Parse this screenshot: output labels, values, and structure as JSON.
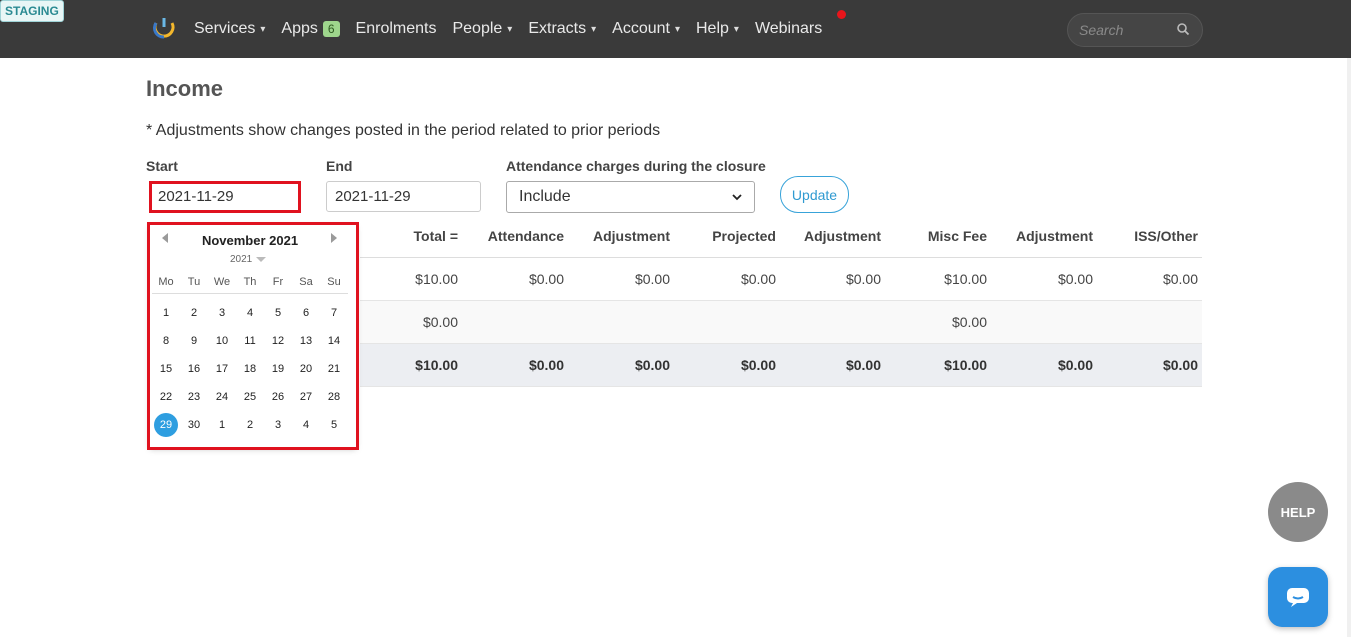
{
  "env_badge": "STAGING",
  "nav": {
    "items": [
      {
        "label": "Services",
        "dropdown": true
      },
      {
        "label": "Apps",
        "badge": "6"
      },
      {
        "label": "Enrolments"
      },
      {
        "label": "People",
        "dropdown": true
      },
      {
        "label": "Extracts",
        "dropdown": true
      },
      {
        "label": "Account",
        "dropdown": true
      },
      {
        "label": "Help",
        "dropdown": true
      },
      {
        "label": "Webinars"
      }
    ],
    "search_placeholder": "Search",
    "caret": "▾"
  },
  "page": {
    "title": "Income",
    "note": "* Adjustments show changes posted in the period related to prior periods"
  },
  "filters": {
    "start_label": "Start",
    "start_value": "2021-11-29",
    "end_label": "End",
    "end_value": "2021-11-29",
    "closure_label": "Attendance charges during the closure",
    "closure_value": "Include",
    "update_label": "Update"
  },
  "table": {
    "headers": [
      "Total =",
      "Attendance",
      "Adjustment",
      "Projected",
      "Adjustment",
      "Misc Fee",
      "Adjustment",
      "ISS/Other"
    ],
    "rows": [
      [
        "$10.00",
        "$0.00",
        "$0.00",
        "$0.00",
        "$0.00",
        "$10.00",
        "$0.00",
        "$0.00"
      ],
      [
        "$0.00",
        "",
        "",
        "",
        "",
        "$0.00",
        "",
        ""
      ],
      [
        "$10.00",
        "$0.00",
        "$0.00",
        "$0.00",
        "$0.00",
        "$10.00",
        "$0.00",
        "$0.00"
      ]
    ]
  },
  "datepicker": {
    "month_title": "November 2021",
    "year": "2021",
    "weekdays": [
      "Mo",
      "Tu",
      "We",
      "Th",
      "Fr",
      "Sa",
      "Su"
    ],
    "weeks": [
      [
        "1",
        "2",
        "3",
        "4",
        "5",
        "6",
        "7"
      ],
      [
        "8",
        "9",
        "10",
        "11",
        "12",
        "13",
        "14"
      ],
      [
        "15",
        "16",
        "17",
        "18",
        "19",
        "20",
        "21"
      ],
      [
        "22",
        "23",
        "24",
        "25",
        "26",
        "27",
        "28"
      ],
      [
        "29",
        "30",
        "1",
        "2",
        "3",
        "4",
        "5"
      ]
    ],
    "selected": "29"
  },
  "help_button": "HELP",
  "colors": {
    "accent": "#2e9ee0",
    "highlight": "#e0121f",
    "nav_bg": "#3a3a3a"
  }
}
